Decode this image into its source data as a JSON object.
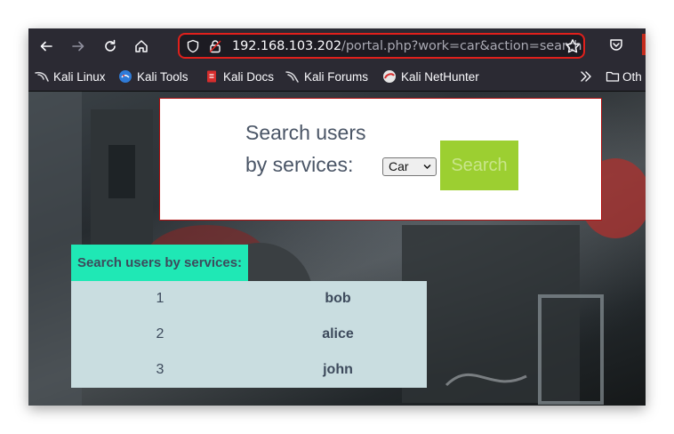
{
  "browser": {
    "url_host": "192.168.103.202",
    "url_path": "/portal.php?work=car&action=search",
    "bookmarks": [
      {
        "label": "Kali Linux",
        "icon": "kali-dragon-icon"
      },
      {
        "label": "Kali Tools",
        "icon": "kali-tools-icon"
      },
      {
        "label": "Kali Docs",
        "icon": "kali-docs-icon"
      },
      {
        "label": "Kali Forums",
        "icon": "kali-forums-icon"
      },
      {
        "label": "Kali NetHunter",
        "icon": "kali-nethunter-icon"
      }
    ],
    "other_bookmarks": "Oth"
  },
  "search": {
    "label_line1": "Search users",
    "label_line2": "by services:",
    "selected": "Car",
    "button": "Search"
  },
  "results": {
    "heading": "Search users by services:",
    "rows": [
      {
        "id": "1",
        "name": "bob"
      },
      {
        "id": "2",
        "name": "alice"
      },
      {
        "id": "3",
        "name": "john"
      }
    ]
  },
  "colors": {
    "url_highlight": "#e0201c",
    "search_button": "#9ccf31",
    "results_heading": "#1fe8b5",
    "results_table": "#c9dde0"
  }
}
